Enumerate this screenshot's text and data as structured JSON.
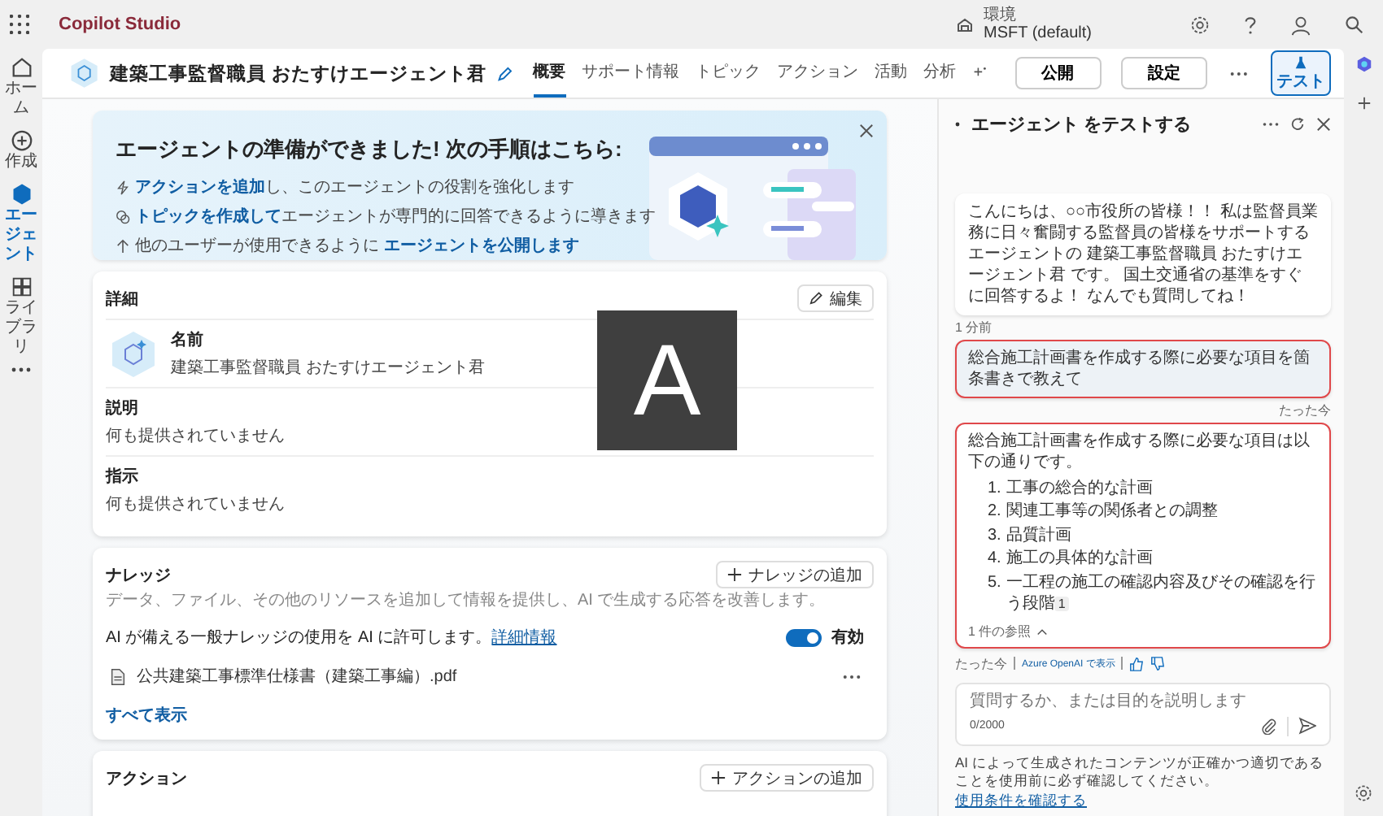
{
  "app_title": "Copilot Studio",
  "environment": {
    "label": "環境",
    "value": "MSFT (default)"
  },
  "nav_rail": [
    {
      "kind": "home",
      "label": "ホーム",
      "selected": false
    },
    {
      "kind": "create",
      "label": "作成",
      "selected": false
    },
    {
      "kind": "agents",
      "label": "エージェント",
      "selected": true
    },
    {
      "kind": "library",
      "label": "ライブラリ",
      "selected": false
    }
  ],
  "agent_name": "建築工事監督職員 おたすけエージェント君",
  "tabs": [
    {
      "label": "概要",
      "selected": true
    },
    {
      "label": "サポート情報",
      "selected": false
    },
    {
      "label": "トピック",
      "selected": false
    },
    {
      "label": "アクション",
      "selected": false
    },
    {
      "label": "活動",
      "selected": false
    },
    {
      "label": "分析",
      "selected": false
    }
  ],
  "header_buttons": [
    "公開",
    "設定"
  ],
  "test_button": {
    "label": "テスト",
    "selected": true
  },
  "banner": {
    "title": "エージェントの準備ができました! 次の手順はこちら:",
    "steps": [
      {
        "kind": "action",
        "link": "アクションを追加",
        "after": "し、このエージェントの役割を強化します"
      },
      {
        "kind": "topic",
        "link": "トピックを作成して",
        "after": "エージェントが専門的に回答できるように導きます"
      },
      {
        "kind": "publish",
        "before": "他のユーザーが使用できるように ",
        "link": "エージェントを公開します"
      }
    ]
  },
  "details": {
    "title": "詳細",
    "edit_button": "編集",
    "fields": [
      {
        "label": "名前",
        "value": "建築工事監督職員 おたすけエージェント君"
      },
      {
        "label": "説明",
        "value": "何も提供されていません"
      },
      {
        "label": "指示",
        "value": "何も提供されていません"
      }
    ]
  },
  "overlay_letter": "A",
  "knowledge": {
    "title": "ナレッジ",
    "add_button": "ナレッジの追加",
    "description": "データ、ファイル、その他のリソースを追加して情報を提供し、AI で生成する応答を改善します。",
    "general": {
      "text": "AI が備える一般ナレッジの使用を AI に許可します。",
      "link": "詳細情報",
      "on": true,
      "state_label": "有効"
    },
    "files": [
      "公共建築工事標準仕様書（建築工事編）.pdf"
    ],
    "show_all": "すべて表示"
  },
  "actions": {
    "title": "アクション",
    "add_button": "アクションの追加"
  },
  "chat": {
    "title": "エージェント をテストする",
    "messages": [
      {
        "kind": "bot",
        "highlighted": false,
        "text": "こんにちは、○○市役所の皆様！！ 私は監督員業務に日々奮闘する監督員の皆様をサポートするエージェントの 建築工事監督職員 おたすけエージェント君 です。 国土交通省の基準をすぐに回答するよ！ なんでも質問してね！",
        "time": "1 分前"
      },
      {
        "kind": "user",
        "highlighted": true,
        "text": "総合施工計画書を作成する際に必要な項目を箇条書きで教えて",
        "time": "たった今"
      },
      {
        "kind": "bot",
        "highlighted": true,
        "text": "総合施工計画書を作成する際に必要な項目は以下の通りです。",
        "list": [
          {
            "number": "1.",
            "text": "工事の総合的な計画"
          },
          {
            "number": "2.",
            "text": "関連工事等の関係者との調整"
          },
          {
            "number": "3.",
            "text": "品質計画"
          },
          {
            "number": "4.",
            "text": "施工の具体的な計画"
          },
          {
            "number": "5.",
            "text": "一工程の施工の確認内容及びその確認を行う段階",
            "citation": "1"
          }
        ],
        "references": "1 件の参照"
      }
    ],
    "meta": {
      "time": "たった今",
      "source": "Azure OpenAI で表示"
    },
    "input": {
      "placeholder": "質問するか、または目的を説明します",
      "counter": "0/2000"
    },
    "disclaimer": {
      "text": "AI によって生成されたコンテンツが正確かつ適切であることを使用前に必ず確認してください。",
      "link": "使用条件を確認する"
    }
  }
}
